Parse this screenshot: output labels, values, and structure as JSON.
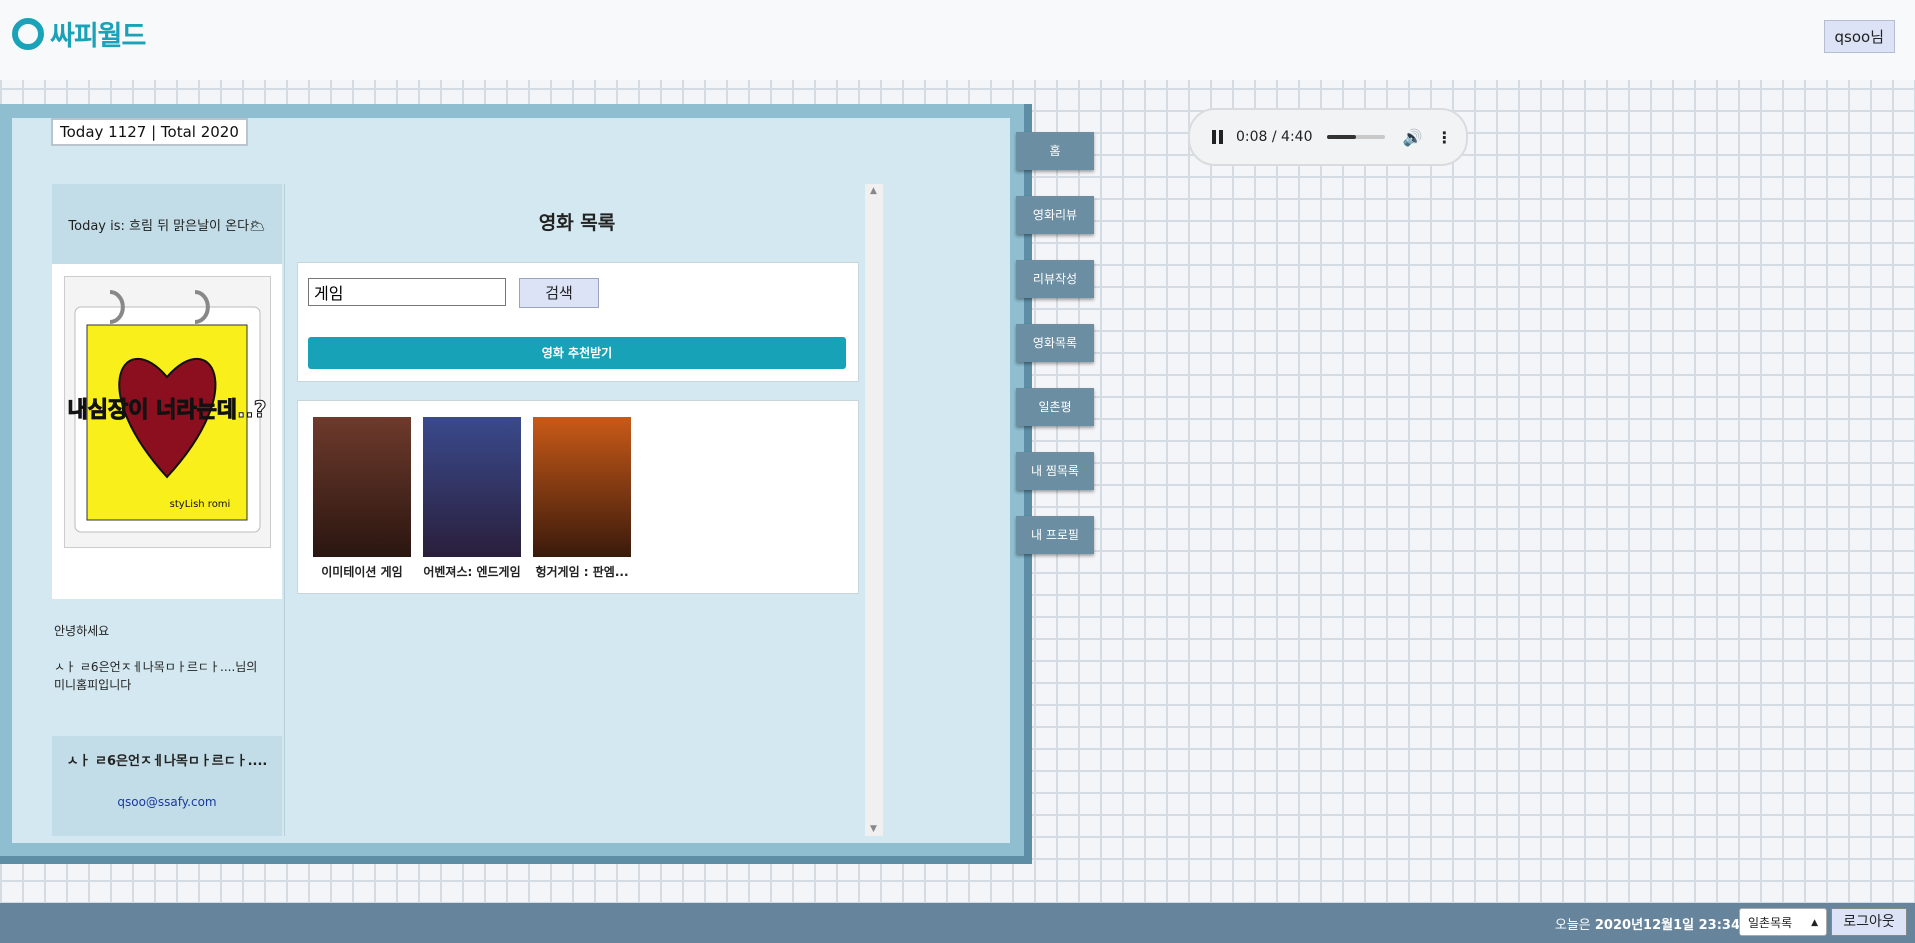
{
  "header": {
    "logo_text": "싸피월드",
    "user_button": "qsoo님"
  },
  "counter": "Today 1127 | Total 2020",
  "sidebar": {
    "weather": "Today is: 흐림 뒤 맑은날이 온다🌥",
    "greeting_line1": "안녕하세요",
    "greeting_line2": "ㅅㅏ ㄹ6은언ㅈㅔ나목ㅁㅏ르ㄷㅏ....님의 미니홈피입니다",
    "profile_name": "ㅅㅏ ㄹ6은언ㅈㅔ나목ㅁㅏ르ㄷㅏ....",
    "profile_email": "qsoo@ssafy.com",
    "photo_text_main": "내심장이 너라는데..?",
    "photo_text_sub": "styLish romi"
  },
  "main": {
    "title": "영화 목록",
    "search_value": "게임",
    "search_button": "검색",
    "recommend_button": "영화 추천받기",
    "movies": [
      {
        "title": "이미테이션 게임",
        "color_top": "#6e3a2c",
        "color_bottom": "#2a1610"
      },
      {
        "title": "어벤져스: 엔드게임",
        "color_top": "#3a4a8c",
        "color_bottom": "#2a1f3c"
      },
      {
        "title": "헝거게임 : 판엠...",
        "color_top": "#c95a18",
        "color_bottom": "#3a1a0c"
      }
    ]
  },
  "nav": [
    {
      "label": "홈"
    },
    {
      "label": "영화리뷰"
    },
    {
      "label": "리뷰작성"
    },
    {
      "label": "영화목록"
    },
    {
      "label": "일촌평"
    },
    {
      "label": "내 찜목록"
    },
    {
      "label": "내 프로필"
    }
  ],
  "audio": {
    "time": "0:08 / 4:40",
    "progress": 0.5
  },
  "footer": {
    "date_prefix": "오늘은 ",
    "date_value": "2020년12월1일 23:34",
    "select_value": "일촌목록",
    "logout": "로그아웃"
  },
  "colors": {
    "brand": "#1aa2b8",
    "nav_bg": "#6b8ea3",
    "footer_bg": "#66849c"
  }
}
